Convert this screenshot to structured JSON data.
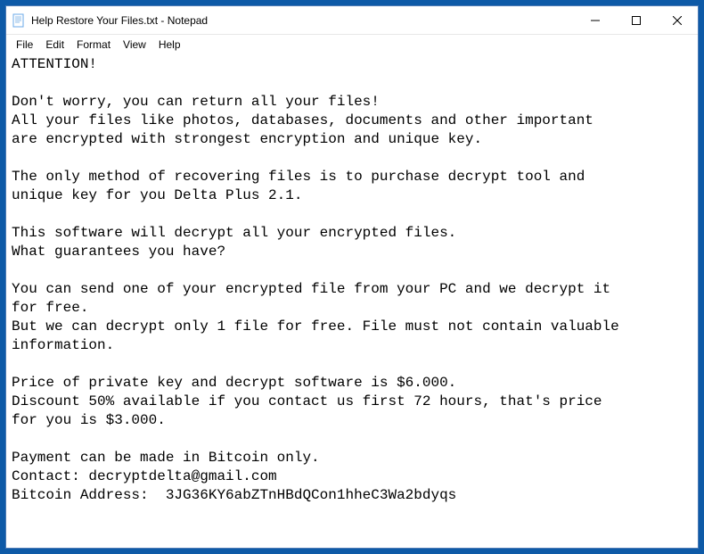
{
  "window": {
    "title": "Help Restore Your Files.txt - Notepad"
  },
  "menu": {
    "file": "File",
    "edit": "Edit",
    "format": "Format",
    "view": "View",
    "help": "Help"
  },
  "document": {
    "body": "ATTENTION!\n\nDon't worry, you can return all your files!\nAll your files like photos, databases, documents and other important\nare encrypted with strongest encryption and unique key.\n\nThe only method of recovering files is to purchase decrypt tool and\nunique key for you Delta Plus 2.1.\n\nThis software will decrypt all your encrypted files.\nWhat guarantees you have?\n\nYou can send one of your encrypted file from your PC and we decrypt it\nfor free.\nBut we can decrypt only 1 file for free. File must not contain valuable\ninformation.\n\nPrice of private key and decrypt software is $6.000.\nDiscount 50% available if you contact us first 72 hours, that's price\nfor you is $3.000.\n\nPayment can be made in Bitcoin only.\nContact: decryptdelta@gmail.com\nBitcoin Address:  3JG36KY6abZTnHBdQCon1hheC3Wa2bdyqs"
  }
}
